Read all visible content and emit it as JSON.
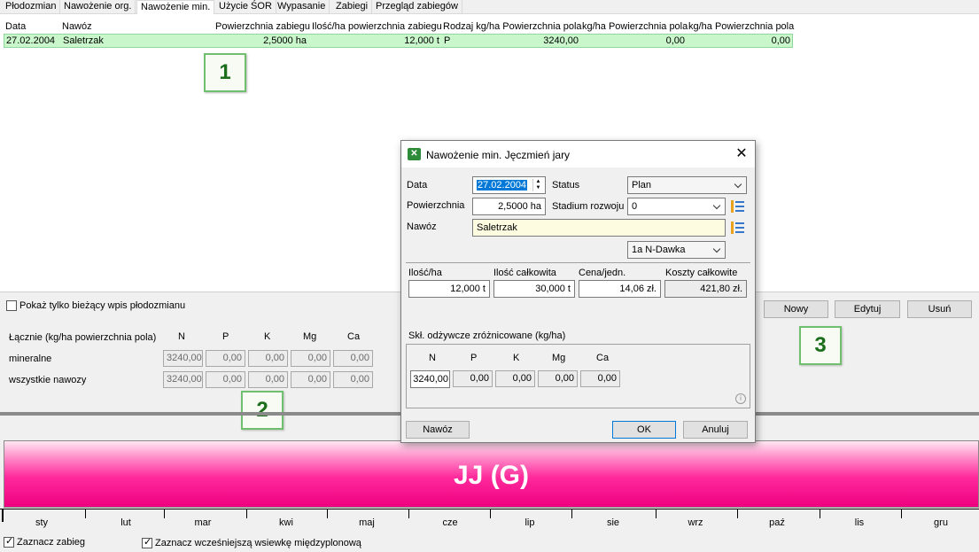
{
  "tabs": [
    "Płodozmian",
    "Nawożenie org.",
    "Nawożenie min.",
    "Użycie ŚOR",
    "Wypasanie",
    "Zabiegi",
    "Przegląd zabiegów"
  ],
  "table": {
    "headers": [
      "Data",
      "Nawóz",
      "Powierzchnia zabiegu",
      "Ilość/ha powierzchnia zabiegu",
      "Rodzaj kg/ha Powierzchnia pola",
      "kg/ha Powierzchnia pola",
      "kg/ha Powierzchnia pola"
    ],
    "rows": [
      [
        "27.02.2004",
        "Saletrzak",
        "2,5000 ha",
        "12,000 t",
        "P",
        "3240,00",
        "0,00",
        "0,00"
      ]
    ]
  },
  "markers": [
    "1",
    "2",
    "3"
  ],
  "show_current_only": "Pokaż tylko bieżący wpis płodozmianu",
  "summary": {
    "title": "Łącznie (kg/ha powierzchnia pola)",
    "columns": [
      "N",
      "P",
      "K",
      "Mg",
      "Ca"
    ],
    "rows": [
      {
        "label": "mineralne",
        "values": [
          "3240,00",
          "0,00",
          "0,00",
          "0,00",
          "0,00"
        ]
      },
      {
        "label": "wszystkie nawozy",
        "values": [
          "3240,00",
          "0,00",
          "0,00",
          "0,00",
          "0,00"
        ]
      }
    ]
  },
  "buttons": {
    "new": "Nowy",
    "edit": "Edytuj",
    "delete": "Usuń"
  },
  "band_label": "JJ (G)",
  "months": [
    "sty",
    "lut",
    "mar",
    "kwi",
    "maj",
    "cze",
    "lip",
    "sie",
    "wrz",
    "paź",
    "lis",
    "gru"
  ],
  "footer": {
    "mark_treatment": "Zaznacz zabieg",
    "mark_earlier": "Zaznacz wcześniejszą wsiewkę międzyplonową"
  },
  "dialog": {
    "title": "Nawożenie min.  Jęczmień jary",
    "date_label": "Data",
    "date_value": "27.02.2004",
    "status_label": "Status",
    "status_value": "Plan",
    "area_label": "Powierzchnia",
    "area_value": "2,5000 ha",
    "stage_label": "Stadium rozwoju",
    "stage_value": "0",
    "fert_label": "Nawóz",
    "fert_value": "Saletrzak",
    "dose_value": "1a N-Dawka",
    "qty_label": "Ilość/ha",
    "qty_value": "12,000 t",
    "total_label": "Ilość całkowita",
    "total_value": "30,000 t",
    "price_label": "Cena/jedn.",
    "price_value": "14,06 zł.",
    "cost_label": "Koszty całkowite",
    "cost_value": "421,80 zł.",
    "nutrients_title": "Skł. odżywcze zróżnicowane (kg/ha)",
    "nutrient_cols": [
      "N",
      "P",
      "K",
      "Mg",
      "Ca"
    ],
    "nutrient_vals": [
      "3240,00",
      "0,00",
      "0,00",
      "0,00",
      "0,00"
    ],
    "btn_fert": "Nawóz",
    "btn_ok": "OK",
    "btn_cancel": "Anuluj"
  }
}
